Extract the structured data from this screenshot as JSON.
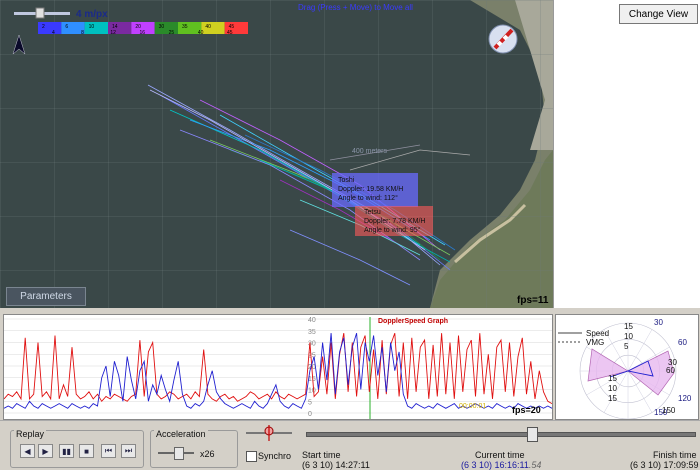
{
  "map": {
    "zoom_label": "4 m/px",
    "drag_hint": "Drag (Press + Move) to Move all",
    "distance_label": "400 meters",
    "parameters_label": "Parameters",
    "fps": "fps=11",
    "legend_top": [
      "2",
      "6",
      "10",
      "14",
      "20",
      "30",
      "35",
      "40",
      "45"
    ],
    "legend_bottom": [
      "4",
      "8",
      "12",
      "16",
      "25",
      "40",
      "45"
    ],
    "legend_colors": [
      "#3a3aff",
      "#2f8fff",
      "#00c0c0",
      "#7a2aa0",
      "#c040ff",
      "#2a8a2a",
      "#60c020",
      "#d0d020",
      "#ff3a3a"
    ],
    "tooltip_1": {
      "name": "Toshi",
      "doppler": "Doppler: 19.58 KM/H",
      "angle": "Angle to wind: 112°"
    },
    "tooltip_2": {
      "name": "Tetsu",
      "doppler": "Doppler: 7.78 KM/H",
      "angle": "Angle to wind: 95°"
    }
  },
  "right_panel": {
    "change_view": "Change View"
  },
  "graph": {
    "title": "DopplerSpeed Graph",
    "y_ticks": [
      "40",
      "35",
      "30",
      "25",
      "20",
      "15",
      "10",
      "5",
      "0"
    ],
    "fps": "fps=20",
    "time_label": "00:00:01",
    "red": [
      6,
      8,
      7,
      9,
      6,
      32,
      6,
      8,
      30,
      7,
      9,
      6,
      33,
      6,
      12,
      7,
      28,
      8,
      6,
      7,
      9,
      6,
      8,
      5,
      7,
      6,
      8,
      7,
      6,
      5,
      7,
      8,
      31,
      7,
      26,
      30,
      8,
      6,
      7,
      9,
      8,
      6,
      7,
      8,
      6,
      9,
      7,
      27,
      8,
      6,
      5,
      7,
      8,
      6,
      7,
      5,
      6,
      7,
      9,
      8,
      6,
      7,
      8,
      6,
      9,
      7,
      6,
      8,
      7,
      6,
      7,
      8,
      30,
      7,
      9,
      24,
      8,
      30,
      6,
      25,
      34,
      9,
      30,
      7,
      28,
      33,
      9,
      27,
      6,
      31,
      8,
      29,
      34,
      7,
      30,
      6,
      32,
      9,
      28,
      31,
      6,
      29,
      7,
      34,
      8,
      30,
      6,
      33,
      9,
      27,
      31,
      7,
      34,
      8,
      25,
      6,
      28,
      31,
      9,
      30,
      7,
      24,
      32,
      8,
      22,
      6,
      18,
      9,
      5,
      4
    ],
    "blue": [
      2,
      3,
      2,
      4,
      3,
      2,
      5,
      3,
      2,
      4,
      3,
      2,
      3,
      4,
      3,
      2,
      4,
      3,
      2,
      3,
      2,
      4,
      3,
      15,
      20,
      7,
      22,
      16,
      5,
      24,
      14,
      6,
      18,
      22,
      5,
      12,
      8,
      16,
      10,
      5,
      14,
      22,
      8,
      3,
      2,
      4,
      3,
      5,
      12,
      18,
      9,
      6,
      4,
      3,
      2,
      3,
      4,
      3,
      2,
      5,
      3,
      2,
      4,
      8,
      12,
      5,
      3,
      2,
      4,
      3,
      2,
      6,
      18,
      24,
      10,
      30,
      14,
      34,
      8,
      26,
      32,
      12,
      28,
      34,
      10,
      30,
      22,
      33,
      16,
      28,
      9,
      30,
      18,
      26,
      8,
      3,
      2,
      4,
      3,
      2,
      3,
      2,
      4,
      3,
      2,
      3,
      4,
      2,
      3,
      2,
      3,
      4,
      3,
      2,
      3,
      2,
      4,
      3,
      2,
      3,
      2,
      4,
      3,
      2,
      3,
      2,
      3,
      2,
      3,
      2
    ]
  },
  "polar": {
    "legend": [
      "Speed",
      "VMG"
    ],
    "radial": [
      "15",
      "10",
      "5",
      "15",
      "10",
      "15",
      "30",
      "60",
      "150"
    ],
    "angles": [
      "30",
      "60",
      "120",
      "150"
    ]
  },
  "controls": {
    "replay_title": "Replay",
    "acceleration_title": "Acceleration",
    "accel_value": "x26",
    "synchro_label": "Synchro",
    "start_label": "Start time",
    "start_value": "(6 3 10) 14:27:11",
    "current_label": "Current time",
    "current_value": "(6 3 10) 16:16:11",
    "current_ms": ".54",
    "finish_label": "Finish time",
    "finish_value": "(6 3 10) 17:09:59",
    "slider_position": 0.58,
    "accel_position": 0.55
  }
}
